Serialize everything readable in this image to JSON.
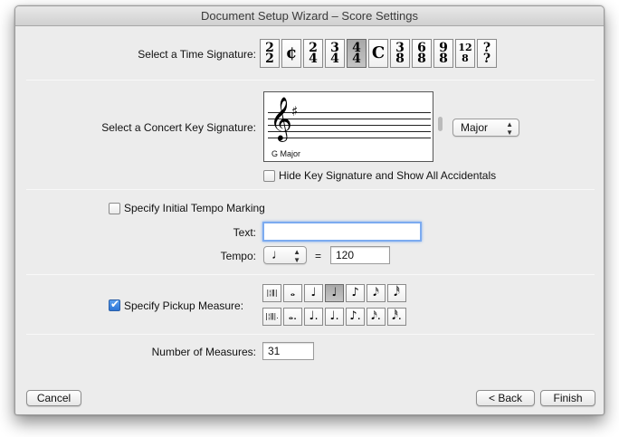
{
  "window": {
    "title": "Document Setup Wizard – Score Settings"
  },
  "time_signature": {
    "label": "Select a Time Signature:",
    "options": [
      {
        "top": "2",
        "bottom": "2"
      },
      {
        "symbol": "¢"
      },
      {
        "top": "2",
        "bottom": "4"
      },
      {
        "top": "3",
        "bottom": "4"
      },
      {
        "top": "4",
        "bottom": "4",
        "selected": true
      },
      {
        "symbol": "C"
      },
      {
        "top": "3",
        "bottom": "8"
      },
      {
        "top": "6",
        "bottom": "8"
      },
      {
        "top": "9",
        "bottom": "8"
      },
      {
        "top": "12",
        "bottom": "8"
      },
      {
        "top": "?",
        "bottom": "?"
      }
    ]
  },
  "key_signature": {
    "label": "Select a Concert Key Signature:",
    "key_name": "G Major",
    "mode_value": "Major",
    "hide_label": "Hide Key Signature and Show All Accidentals",
    "hide_checked": false
  },
  "tempo": {
    "specify_label": "Specify Initial Tempo Marking",
    "specify_checked": false,
    "text_label": "Text:",
    "text_value": "",
    "tempo_label": "Tempo:",
    "note_value": "♩",
    "equals": "=",
    "bpm_value": "120"
  },
  "pickup": {
    "label": "Specify Pickup Measure:",
    "checked": true,
    "row1": [
      "|¦ǁ|",
      "𝅝",
      "♩",
      "♩",
      "♪",
      "𝅘𝅥𝅯",
      "𝅘𝅥𝅰"
    ],
    "row2": [
      "|¦ǁ|.",
      "𝅝.",
      "♩.",
      "♩.",
      "♪.",
      "𝅘𝅥𝅯.",
      "𝅘𝅥𝅰."
    ],
    "selected_index": 3
  },
  "measures": {
    "label": "Number of Measures:",
    "value": "31"
  },
  "buttons": {
    "cancel": "Cancel",
    "back": "< Back",
    "finish": "Finish"
  }
}
